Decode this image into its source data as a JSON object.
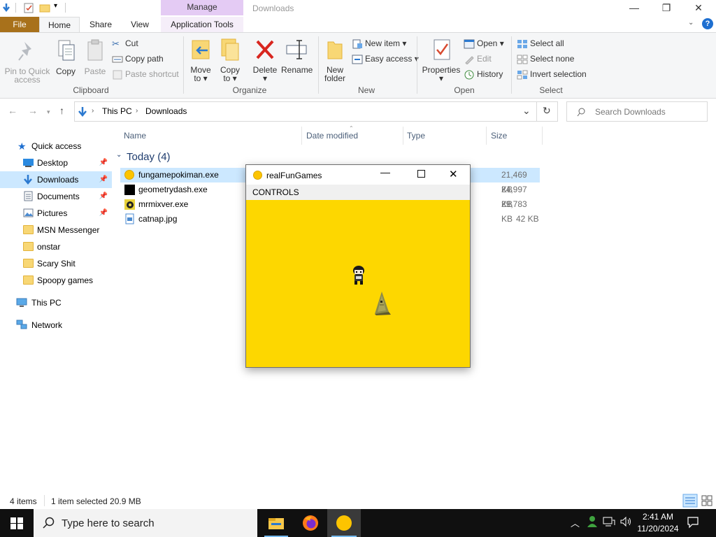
{
  "titlebar": {
    "manage_label": "Manage",
    "window_title": "Downloads",
    "minimize_glyph": "—",
    "maximize_glyph": "❐",
    "close_glyph": "✕"
  },
  "ribbon_tabs": {
    "file": "File",
    "home": "Home",
    "share": "Share",
    "view": "View",
    "app_tools": "Application Tools"
  },
  "clipboard": {
    "pin": [
      "Pin to Quick",
      "access"
    ],
    "copy": "Copy",
    "paste": "Paste",
    "cut": "Cut",
    "copy_path": "Copy path",
    "paste_shortcut": "Paste shortcut",
    "group": "Clipboard"
  },
  "organize": {
    "move_to": [
      "Move",
      "to ▾"
    ],
    "copy_to": [
      "Copy",
      "to ▾"
    ],
    "delete": [
      "Delete",
      "▾"
    ],
    "rename": "Rename",
    "group": "Organize"
  },
  "new_group": {
    "new_folder": [
      "New",
      "folder"
    ],
    "new_item": "New item ▾",
    "easy_access": "Easy access ▾",
    "group": "New"
  },
  "open_group": {
    "properties": [
      "Properties",
      "▾"
    ],
    "open": "Open ▾",
    "edit": "Edit",
    "history": "History",
    "group": "Open"
  },
  "select_group": {
    "select_all": "Select all",
    "select_none": "Select none",
    "invert": "Invert selection",
    "group": "Select"
  },
  "address": {
    "path": [
      "This PC",
      "Downloads"
    ],
    "search_placeholder": "Search Downloads"
  },
  "columns": {
    "name": "Name",
    "date": "Date modified",
    "type": "Type",
    "size": "Size"
  },
  "sidebar": {
    "quick_access": "Quick access",
    "items": [
      {
        "label": "Desktop",
        "pinned": true
      },
      {
        "label": "Downloads",
        "pinned": true,
        "selected": true
      },
      {
        "label": "Documents",
        "pinned": true
      },
      {
        "label": "Pictures",
        "pinned": true
      },
      {
        "label": "MSN Messenger",
        "pinned": false
      },
      {
        "label": "onstar",
        "pinned": false
      },
      {
        "label": "Scary Shit",
        "pinned": false
      },
      {
        "label": "Spoopy games",
        "pinned": false
      }
    ],
    "this_pc": "This PC",
    "network": "Network",
    "pin_glyph": "📌"
  },
  "files": {
    "group_label": "Today (4)",
    "rows": [
      {
        "name": "fungamepokiman.exe",
        "size": "21,469 KB",
        "selected": true
      },
      {
        "name": "geometrydash.exe",
        "size": "24,997 KB"
      },
      {
        "name": "mrmixver.exe",
        "size": "29,783 KB"
      },
      {
        "name": "catnap.jpg",
        "size": "42 KB"
      }
    ]
  },
  "status": {
    "count": "4 items",
    "selection": "1 item selected  20.9 MB"
  },
  "game_window": {
    "title": "realFunGames",
    "menu": "CONTROLS",
    "background_color": "#fdd700"
  },
  "taskbar": {
    "search_placeholder": "Type here to search",
    "time": "2:41 AM",
    "date": "11/20/2024"
  }
}
